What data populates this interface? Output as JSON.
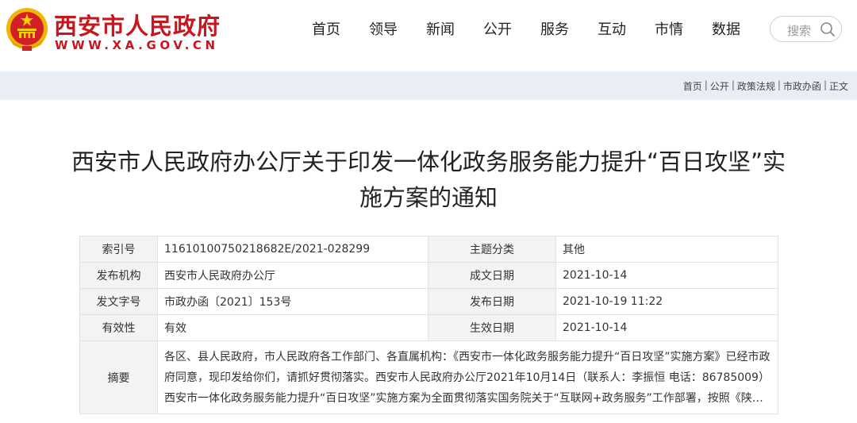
{
  "header": {
    "site_title": "西安市人民政府",
    "site_domain": "WWW.XA.GOV.CN",
    "nav": [
      "首页",
      "领导",
      "新闻",
      "公开",
      "服务",
      "互动",
      "市情",
      "数据"
    ],
    "search": {
      "placeholder": "搜索"
    }
  },
  "breadcrumb": [
    "首页",
    "公开",
    "政策法规",
    "市政办函",
    "正文"
  ],
  "article": {
    "title": "西安市人民政府办公厅关于印发一体化政务服务能力提升“百日攻坚”实施方案的通知"
  },
  "meta": {
    "index_label": "索引号",
    "index_value": "11610100750218682E/2021-028299",
    "topic_label": "主题分类",
    "topic_value": "其他",
    "issuer_label": "发布机构",
    "issuer_value": "西安市人民政府办公厅",
    "written_label": "成文日期",
    "written_value": "2021-10-14",
    "docno_label": "发文字号",
    "docno_value": "市政办函〔2021〕153号",
    "publish_label": "发布日期",
    "publish_value": "2021-10-19 11:22",
    "validity_label": "有效性",
    "validity_value": "有效",
    "effective_label": "生效日期",
    "effective_value": "2021-10-14",
    "abstract_label": "摘要",
    "abstract_value": "各区、县人民政府，市人民政府各工作部门、各直属机构：《西安市一体化政务服务能力提升“百日攻坚”实施方案》已经市政府同意，现印发给你们，请抓好贯彻落实。西安市人民政府办公厅2021年10月14日（联系人：李振恒 电话：86785009）西安市一体化政务服务能力提升“百日攻坚”实施方案为全面贯彻落实国务院关于“互联网+政务服务”工作部署，按照《陕西省政务服务能力..."
  },
  "colors": {
    "brand_red": "#c8161e",
    "emblem_gold": "#f5c200",
    "crumb_bg": "#e9eef5",
    "label_bg": "#f3f3f3"
  }
}
